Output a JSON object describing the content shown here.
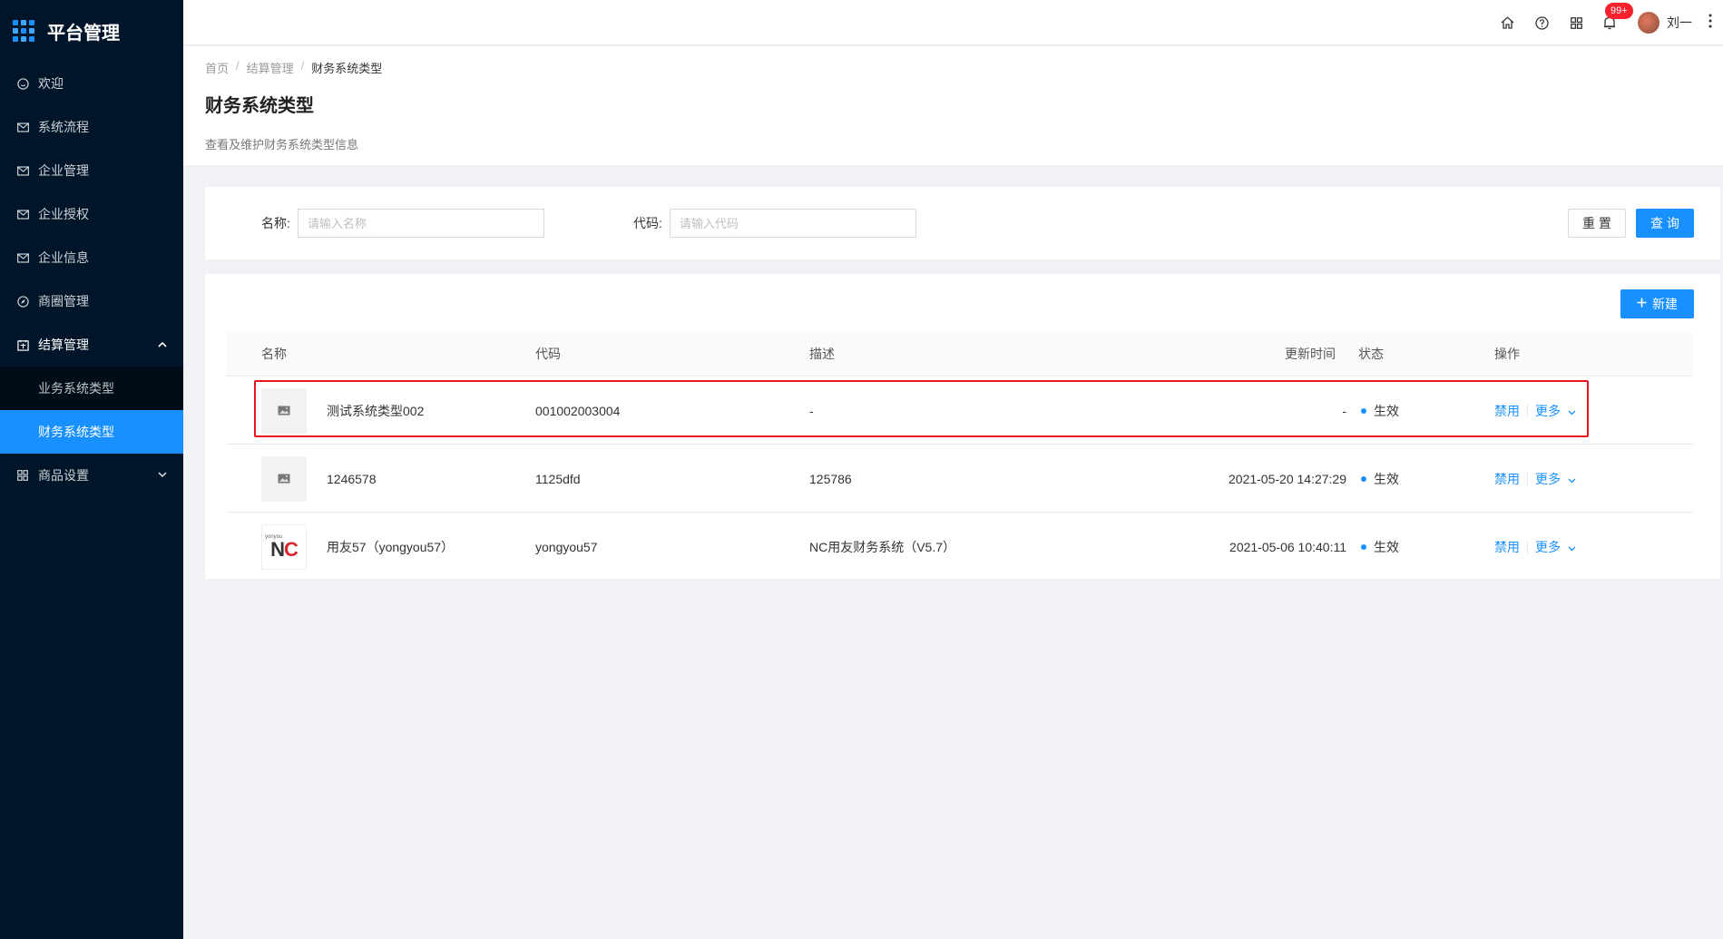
{
  "app": {
    "title": "平台管理"
  },
  "sidebar": {
    "items": [
      {
        "label": "欢迎",
        "icon": "smile-icon"
      },
      {
        "label": "系统流程",
        "icon": "mail-icon"
      },
      {
        "label": "企业管理",
        "icon": "mail-icon"
      },
      {
        "label": "企业授权",
        "icon": "mail-icon"
      },
      {
        "label": "企业信息",
        "icon": "mail-icon"
      },
      {
        "label": "商圈管理",
        "icon": "compass-icon"
      },
      {
        "label": "结算管理",
        "icon": "calendar-icon",
        "expanded": true
      },
      {
        "label": "商品设置",
        "icon": "appstore-icon",
        "expanded": false
      }
    ],
    "settlement_children": [
      {
        "label": "业务系统类型",
        "active": false
      },
      {
        "label": "财务系统类型",
        "active": true
      }
    ]
  },
  "topbar": {
    "notification_badge": "99+",
    "username": "刘一"
  },
  "breadcrumb": [
    "首页",
    "结算管理",
    "财务系统类型"
  ],
  "page": {
    "title": "财务系统类型",
    "description": "查看及维护财务系统类型信息"
  },
  "search": {
    "name_label": "名称:",
    "name_placeholder": "请输入名称",
    "code_label": "代码:",
    "code_placeholder": "请输入代码",
    "reset_label": "重 置",
    "query_label": "查 询"
  },
  "table": {
    "new_button": "新建",
    "columns": {
      "name": "名称",
      "code": "代码",
      "desc": "描述",
      "updated": "更新时间",
      "status": "状态",
      "actions": "操作"
    },
    "rows": [
      {
        "name": "测试系统类型002",
        "code": "001002003004",
        "desc": "-",
        "updated": "-",
        "status": "生效",
        "disable": "禁用",
        "more": "更多",
        "logo": "placeholder"
      },
      {
        "name": "1246578",
        "code": "1125dfd",
        "desc": "125786",
        "updated": "2021-05-20 14:27:29",
        "status": "生效",
        "disable": "禁用",
        "more": "更多",
        "logo": "placeholder"
      },
      {
        "name": "用友57（yongyou57）",
        "code": "yongyou57",
        "desc": "NC用友财务系统（V5.7）",
        "updated": "2021-05-06 10:40:11",
        "status": "生效",
        "disable": "禁用",
        "more": "更多",
        "logo": "nc"
      }
    ],
    "nc_logo": {
      "small": "yonyou",
      "n": "N",
      "c": "C"
    }
  },
  "colors": {
    "primary": "#1890ff",
    "sidebar_bg": "#001529",
    "highlight": "#e3161b",
    "badge": "#f5222d"
  }
}
